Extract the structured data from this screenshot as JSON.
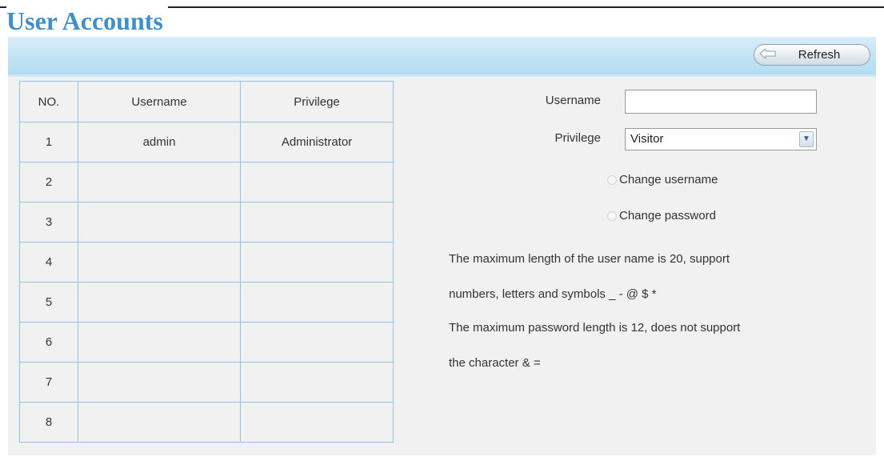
{
  "page": {
    "title": "User Accounts"
  },
  "toolbar": {
    "refresh_label": "Refresh"
  },
  "table": {
    "headers": [
      "NO.",
      "Username",
      "Privilege"
    ],
    "rows": [
      {
        "no": "1",
        "username": "admin",
        "privilege": "Administrator"
      },
      {
        "no": "2",
        "username": "",
        "privilege": ""
      },
      {
        "no": "3",
        "username": "",
        "privilege": ""
      },
      {
        "no": "4",
        "username": "",
        "privilege": ""
      },
      {
        "no": "5",
        "username": "",
        "privilege": ""
      },
      {
        "no": "6",
        "username": "",
        "privilege": ""
      },
      {
        "no": "7",
        "username": "",
        "privilege": ""
      },
      {
        "no": "8",
        "username": "",
        "privilege": ""
      }
    ]
  },
  "form": {
    "username_label": "Username",
    "username_value": "",
    "privilege_label": "Privilege",
    "privilege_value": "Visitor",
    "change_username_label": "Change username",
    "change_password_label": "Change password",
    "notes": [
      "The maximum length of the user name is 20, support",
      "numbers, letters and symbols _ - @ $ *",
      "The maximum password length is 12, does not support",
      "the character & ="
    ]
  },
  "colors": {
    "title": "#3f8fca",
    "toolbar": "#bfe2f4",
    "grid": "#8cc6e2",
    "panel": "#f1f1f1"
  }
}
